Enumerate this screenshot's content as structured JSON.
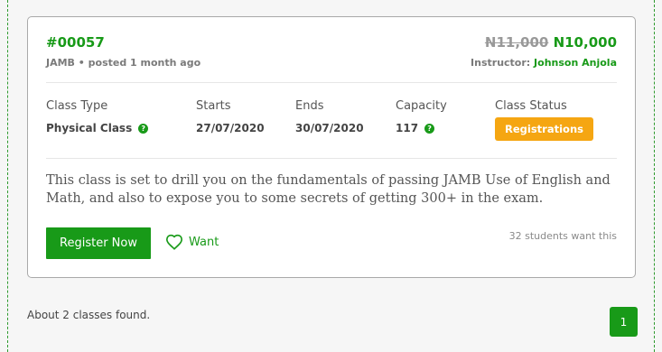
{
  "class": {
    "id": "#00057",
    "category": "JAMB",
    "posted": "posted 1 month ago",
    "old_price": "N11,000",
    "new_price": "N10,000",
    "instructor_label": "Instructor:",
    "instructor_name": "Johnson Anjola",
    "columns": [
      {
        "label": "Class Type",
        "value": "Physical Class"
      },
      {
        "label": "Starts",
        "value": "27/07/2020"
      },
      {
        "label": "Ends",
        "value": "30/07/2020"
      },
      {
        "label": "Capacity",
        "value": "117"
      },
      {
        "label": "Class Status",
        "value": "Registrations"
      }
    ],
    "description": "This class is set to drill you on the fundamentals of passing JAMB Use of English and Math, and also to expose you to some secrets of getting 300+ in the exam.",
    "register_label": "Register Now",
    "want_label": "Want",
    "want_count": "32 students want this"
  },
  "footer": {
    "found_text": "About 2 classes found.",
    "current_page": "1"
  },
  "colors": {
    "brand_green": "#189a18",
    "status_orange": "#f5a612"
  },
  "icons": {
    "help": "question-circle-icon",
    "want": "heart-outline-icon"
  }
}
